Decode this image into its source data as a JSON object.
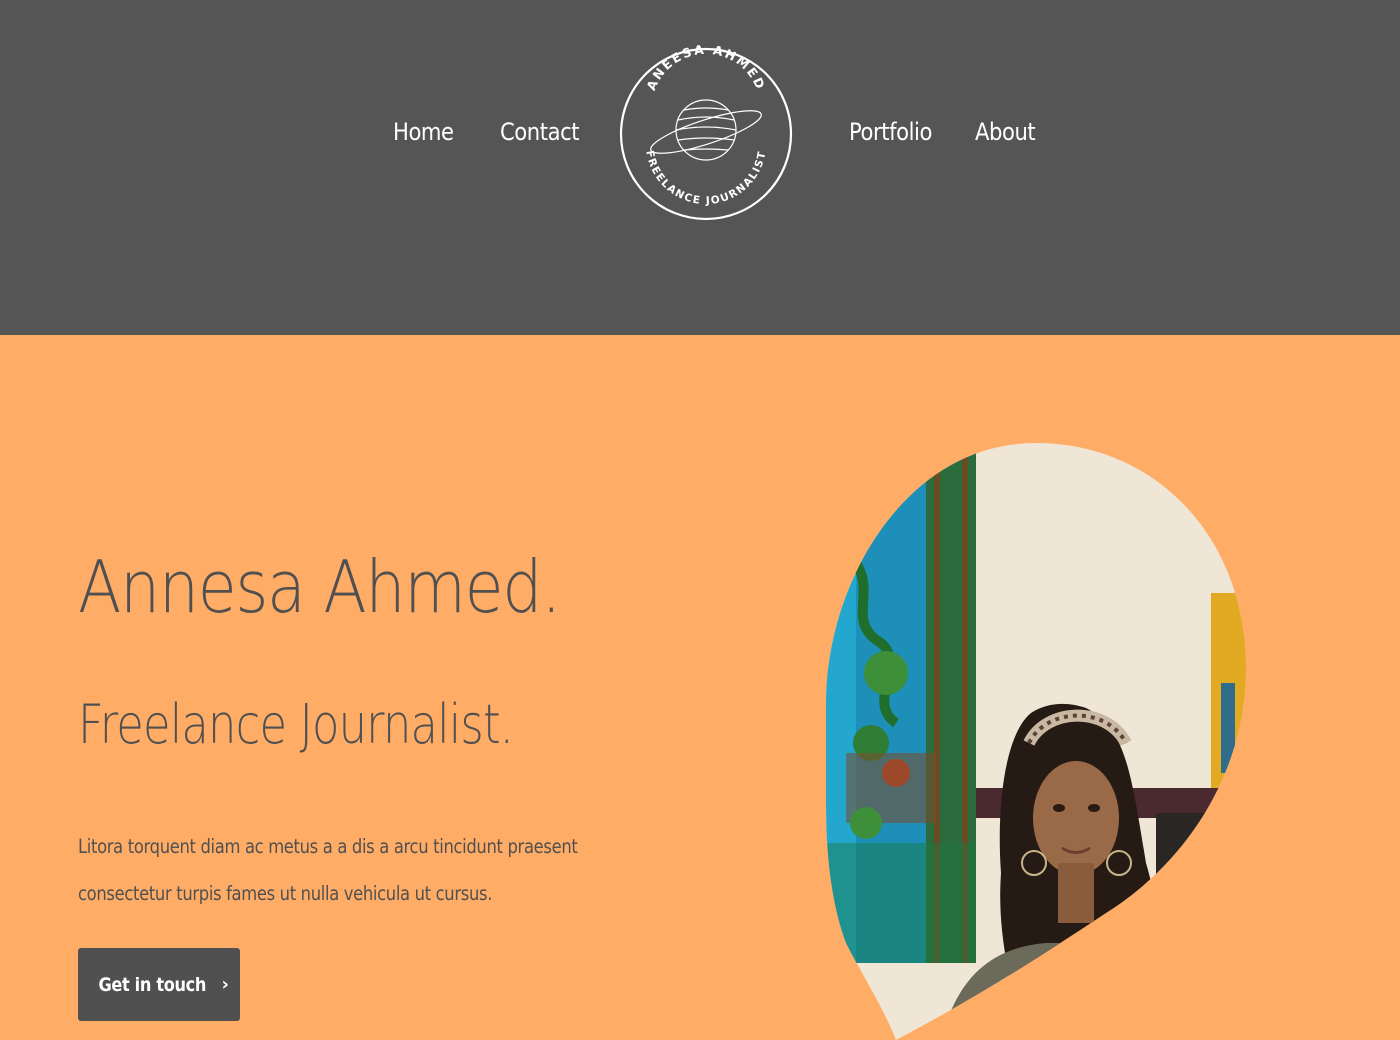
{
  "nav": {
    "items": [
      {
        "label": "Home"
      },
      {
        "label": "Contact"
      },
      {
        "label": "Portfolio"
      },
      {
        "label": "About"
      }
    ]
  },
  "logo": {
    "top_text": "ANEESA AHMED",
    "bottom_text": "FREELANCE JOURNALIST",
    "icon": "saturn-icon"
  },
  "hero": {
    "title": "Annesa Ahmed.",
    "subtitle": "Freelance Journalist.",
    "description": "Litora torquent diam ac metus a a dis a arcu tincidunt praesent consectetur turpis fames ut nulla vehicula ut cursus.",
    "cta_label": "Get in touch",
    "cta_icon": "chevron-right-icon"
  },
  "colors": {
    "header_bg": "#555555",
    "hero_bg": "#ffac66",
    "text_dark": "#505050",
    "button_bg": "#505050"
  }
}
